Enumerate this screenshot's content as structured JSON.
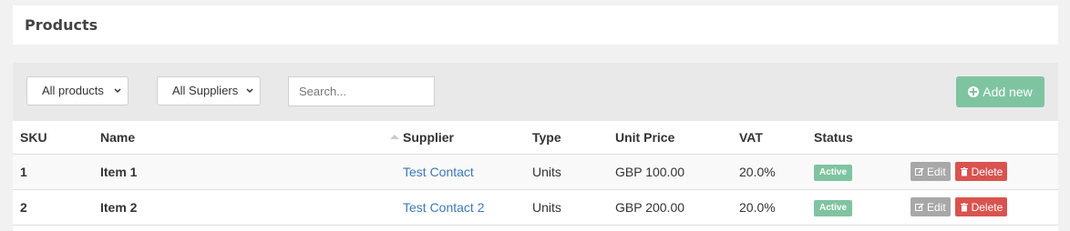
{
  "page": {
    "title": "Products"
  },
  "toolbar": {
    "filter_products": "All products",
    "filter_suppliers": "All Suppliers",
    "search_placeholder": "Search...",
    "add_label": "Add new"
  },
  "table": {
    "headers": {
      "sku": "SKU",
      "name": "Name",
      "supplier": "Supplier",
      "type": "Type",
      "unit_price": "Unit Price",
      "vat": "VAT",
      "status": "Status"
    },
    "rows": [
      {
        "sku": "1",
        "name": "Item 1",
        "supplier": "Test Contact",
        "type": "Units",
        "unit_price": "GBP 100.00",
        "vat": "20.0%",
        "status": "Active",
        "edit": "Edit",
        "delete": "Delete"
      },
      {
        "sku": "2",
        "name": "Item 2",
        "supplier": "Test Contact 2",
        "type": "Units",
        "unit_price": "GBP 200.00",
        "vat": "20.0%",
        "status": "Active",
        "edit": "Edit",
        "delete": "Delete"
      }
    ]
  },
  "colors": {
    "success": "#7fc4a0",
    "danger": "#d9534f",
    "link": "#3c78b5",
    "muted_button": "#a8a8a8"
  },
  "icons": [
    "plus-circle-icon",
    "sort-icon",
    "edit-icon",
    "trash-icon",
    "caret-icon"
  ]
}
